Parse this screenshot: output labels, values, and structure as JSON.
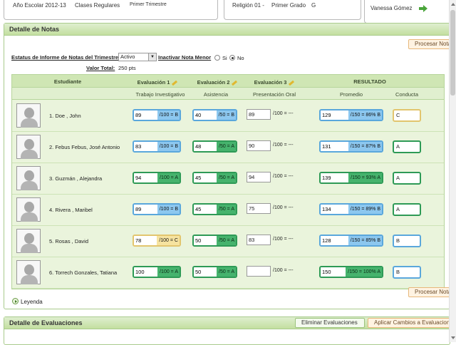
{
  "header": {
    "academic_year": "Año Escolar 2012-13",
    "group_type": "Clases Regulares",
    "term": "Primer Trimestre",
    "course": "Religión 01 -",
    "grade": "Primer Grado",
    "section": "G",
    "user": "Vanessa Gómez"
  },
  "panel": {
    "title": "Detalle de Notas",
    "process_button": "Procesar Nota",
    "status_label": "Estatus de Informe de Notas del Trimestre",
    "status_value": "Activo",
    "inactivate_label": "Inactivar Nota Menor",
    "radio_yes": "Si",
    "radio_no": "No",
    "radio_selected": "No",
    "total_label": "Valor Total:",
    "total_value": "250 pts",
    "legend": "Leyenda"
  },
  "table": {
    "headers": {
      "student": "Estudiante",
      "eval1": "Evaluación 1",
      "eval2": "Evaluación 2",
      "eval3": "Evaluación 3",
      "result": "RESULTADO",
      "eval1_type": "Trabajo Investigativo",
      "eval2_type": "Asistencia",
      "eval3_type": "Presentación Oral",
      "average": "Promedio",
      "conduct": "Conducta"
    },
    "rows": [
      {
        "name": "1. Doe , John",
        "e1": "89",
        "e1s": "/100 = B",
        "e2": "40",
        "e2s": "/50 = B",
        "e3": "89",
        "e3s": "/100 = ---",
        "avg": "129",
        "avgs": "/150 = 86% B",
        "cond": "C"
      },
      {
        "name": "2. Febus Febus, José Antonio",
        "e1": "83",
        "e1s": "/100 = B",
        "e2": "48",
        "e2s": "/50 = A",
        "e3": "90",
        "e3s": "/100 = ---",
        "avg": "131",
        "avgs": "/150 = 87% B",
        "cond": "A"
      },
      {
        "name": "3. Guzmán , Alejandra",
        "e1": "94",
        "e1s": "/100 = A",
        "e2": "45",
        "e2s": "/50 = A",
        "e3": "94",
        "e3s": "/100 = ---",
        "avg": "139",
        "avgs": "/150 = 93% A",
        "cond": "A"
      },
      {
        "name": "4. Rivera , Maribel",
        "e1": "89",
        "e1s": "/100 = B",
        "e2": "45",
        "e2s": "/50 = A",
        "e3": "75",
        "e3s": "/100 = ---",
        "avg": "134",
        "avgs": "/150 = 89% B",
        "cond": "A"
      },
      {
        "name": "5. Rosas , David",
        "e1": "78",
        "e1s": "/100 = C",
        "e2": "50",
        "e2s": "/50 = A",
        "e3": "83",
        "e3s": "/100 = ---",
        "avg": "128",
        "avgs": "/150 = 85% B",
        "cond": "B"
      },
      {
        "name": "6. Torrech Gonzales, Tatiana",
        "e1": "100",
        "e1s": "/100 = A",
        "e2": "50",
        "e2s": "/50 = A",
        "e3": "",
        "e3s": "/100 = ---",
        "avg": "150",
        "avgs": "/150 = 100% A",
        "cond": "B"
      }
    ]
  },
  "evaluations": {
    "title": "Detalle de Evaluaciones",
    "delete_button": "Eliminar Evaluaciones",
    "apply_button": "Aplicar Cambios a Evaluaciones"
  },
  "colors": {
    "panel_green": "#c3df9f",
    "grade_a": "#46b36d",
    "grade_b": "#8cc7ef",
    "grade_c": "#f6e3a0"
  }
}
